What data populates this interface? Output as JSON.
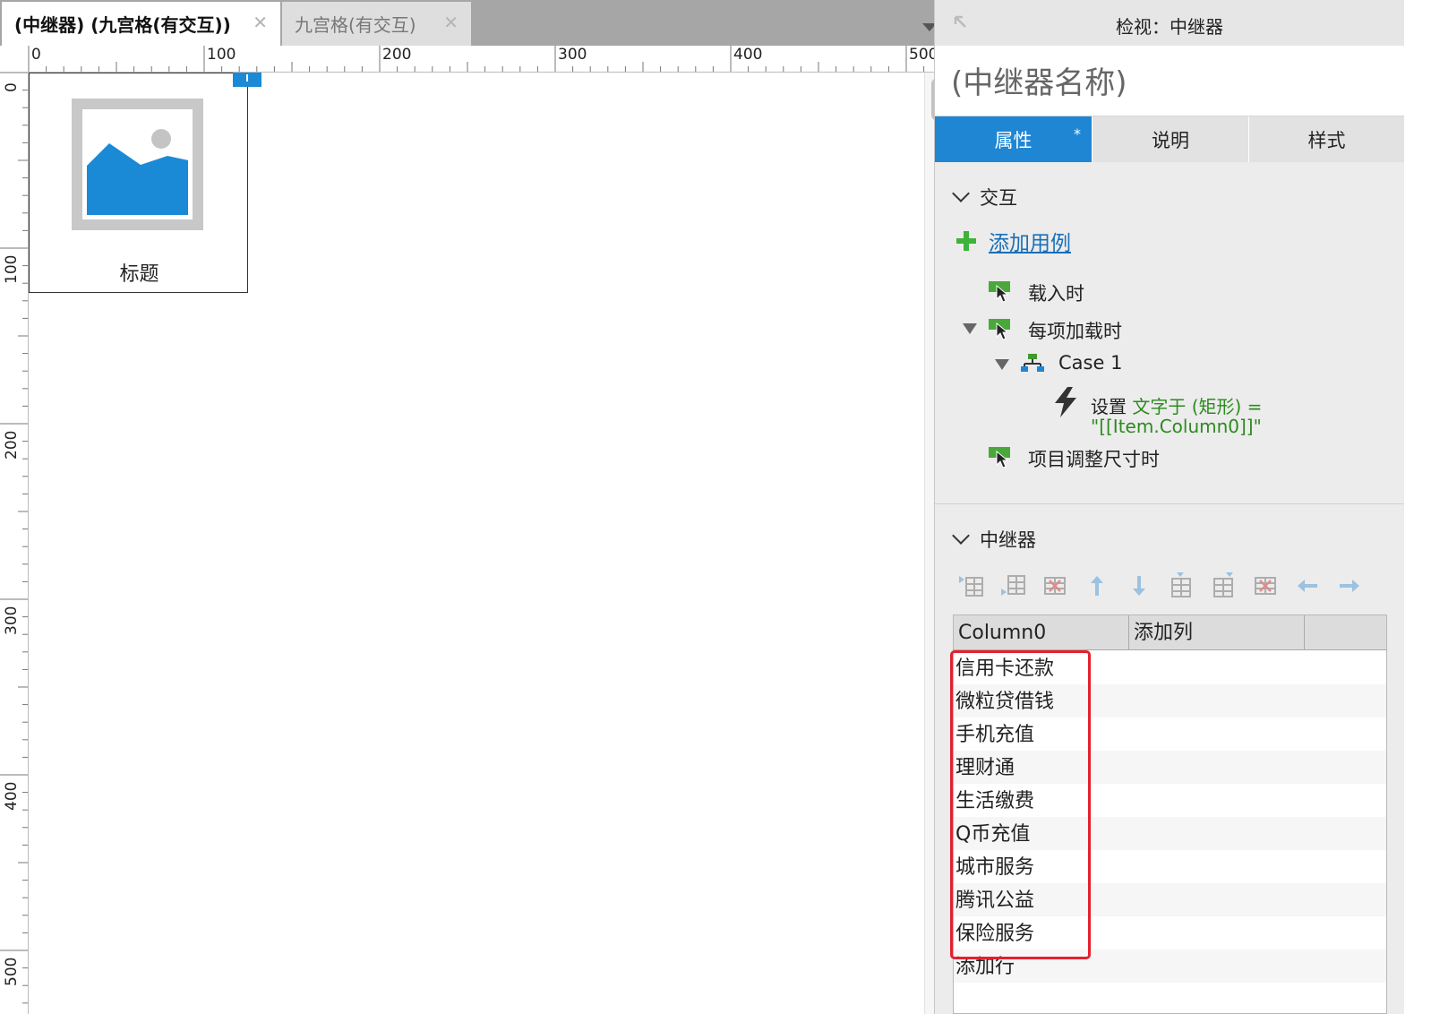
{
  "tabs": [
    {
      "label": "(中继器) (九宫格(有交互))",
      "active": true
    },
    {
      "label": "九宫格(有交互)",
      "active": false
    }
  ],
  "ruler": {
    "horizontal": [
      "0",
      "100",
      "200",
      "300",
      "400",
      "500"
    ],
    "vertical": [
      "0",
      "100",
      "200",
      "300",
      "400",
      "500"
    ]
  },
  "canvas": {
    "widget_title": "标题"
  },
  "inspector": {
    "title": "检视：中继器",
    "name": "(中继器名称)",
    "tabs": [
      {
        "label": "属性",
        "active": true,
        "modified": "*"
      },
      {
        "label": "说明",
        "active": false
      },
      {
        "label": "样式",
        "active": false
      }
    ],
    "interactions": {
      "title": "交互",
      "add_case": "添加用例",
      "events": [
        {
          "label": "载入时"
        },
        {
          "label": "每项加载时"
        },
        {
          "label": "项目调整尺寸时"
        }
      ],
      "case": "Case 1",
      "action": {
        "verb": "设置",
        "target": "文字于 (矩形) =",
        "value": "\"[[Item.Column0]]\""
      }
    },
    "repeater": {
      "title": "中继器",
      "columns": [
        "Column0",
        "添加列"
      ],
      "rows": [
        "信用卡还款",
        "微粒贷借钱",
        "手机充值",
        "理财通",
        "生活缴费",
        "Q币充值",
        "城市服务",
        "腾讯公益",
        "保险服务"
      ],
      "add_row": "添加行"
    }
  },
  "colors": {
    "accent": "#1f86d4",
    "link": "#1a6fb8",
    "event_green": "#4aa83a",
    "action_green": "#2d8a1e",
    "highlight": "#e5202e",
    "image_blue": "#1a8ad6"
  }
}
